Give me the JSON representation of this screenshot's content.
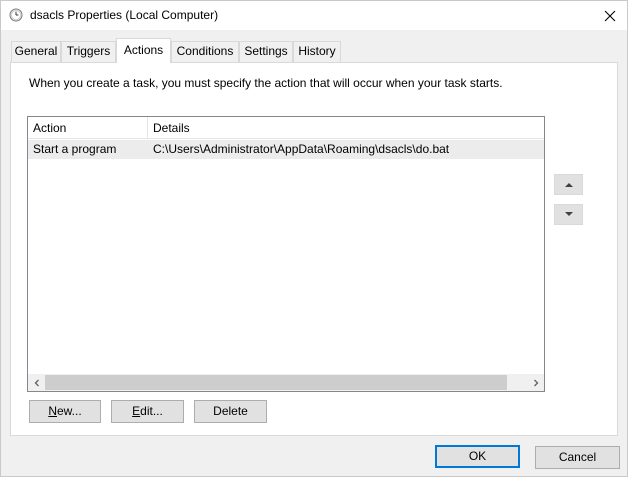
{
  "window": {
    "title": "dsacls Properties (Local Computer)"
  },
  "tabs": [
    {
      "label": "General",
      "active": false
    },
    {
      "label": "Triggers",
      "active": false
    },
    {
      "label": "Actions",
      "active": true
    },
    {
      "label": "Conditions",
      "active": false
    },
    {
      "label": "Settings",
      "active": false
    },
    {
      "label": "History",
      "active": false
    }
  ],
  "actions_tab": {
    "instructions": "When you create a task, you must specify the action that will occur when your task starts.",
    "list": {
      "columns": [
        "Action",
        "Details"
      ],
      "rows": [
        {
          "action": "Start a program",
          "details": "C:\\Users\\Administrator\\AppData\\Roaming\\dsacls\\do.bat"
        }
      ]
    },
    "buttons": {
      "new_mnemonic": "N",
      "new_rest": "ew...",
      "edit_mnemonic": "E",
      "edit_rest": "dit...",
      "delete_label": "Delete"
    }
  },
  "footer": {
    "ok_label": "OK",
    "cancel_label": "Cancel"
  },
  "colors": {
    "accent": "#0078d7",
    "selected_row": "#ececec",
    "panel_bg": "#ffffff",
    "window_bg": "#f0f0f0"
  },
  "icons": {
    "title": "clock-icon",
    "close": "close-icon",
    "move_up": "triangle-up-icon",
    "move_down": "triangle-down-icon",
    "scroll_left": "chevron-left-icon",
    "scroll_right": "chevron-right-icon"
  }
}
